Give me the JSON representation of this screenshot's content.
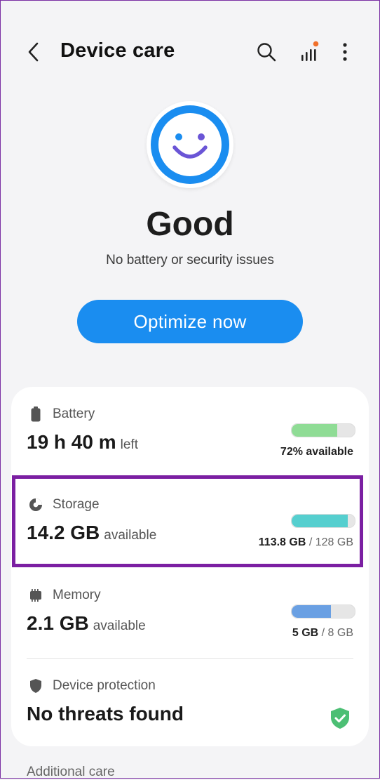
{
  "header": {
    "title": "Device care"
  },
  "status": {
    "title": "Good",
    "subtitle": "No battery or security issues",
    "optimize_label": "Optimize now"
  },
  "battery": {
    "label": "Battery",
    "value": "19 h 40 m",
    "unit": "left",
    "right_text": "72% available",
    "fill_fraction": 0.72,
    "color": "#8fdc95"
  },
  "storage": {
    "label": "Storage",
    "value": "14.2 GB",
    "unit": "available",
    "used": "113.8 GB",
    "total": "/ 128 GB",
    "fill_fraction": 0.889,
    "color": "#55cfcf"
  },
  "memory": {
    "label": "Memory",
    "value": "2.1 GB",
    "unit": "available",
    "used": "5 GB",
    "total": "/ 8 GB",
    "fill_fraction": 0.625,
    "color": "#6aa0e3"
  },
  "protection": {
    "label": "Device protection",
    "value": "No threats found"
  },
  "footer": {
    "additional_label": "Additional care"
  },
  "colors": {
    "accent": "#1a8df0",
    "highlight": "#7b1fa2",
    "shield": "#4cbf74",
    "notify_dot": "#f0702b"
  }
}
